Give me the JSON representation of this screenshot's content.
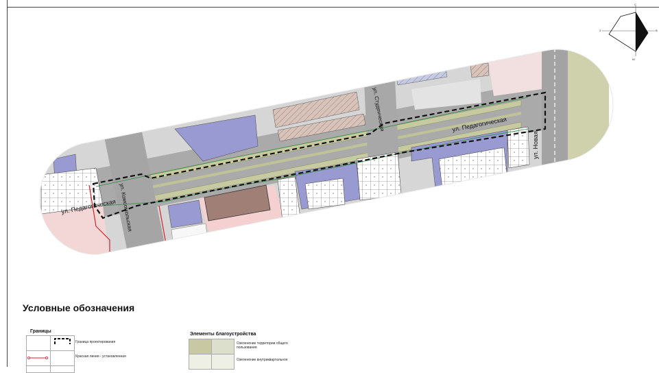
{
  "streets": {
    "pedagogicheskaya_1": "ул. Педагогическая",
    "pedagogicheskaya_2": "ул. Педагогическая",
    "komsomolskaya": "ул. Комсомольская",
    "studencheskaya": "ул. Студенческая",
    "novaya": "ул. Новая"
  },
  "compass": {
    "north_label": "С",
    "south_label": "Ю",
    "west_label": "З",
    "east_label": "В"
  },
  "legend": {
    "title": "Условные обозначения",
    "boundaries_title": "Границы",
    "boundaries": [
      {
        "label": "Граница проектирования"
      },
      {
        "label": "Красная линия - установленная"
      }
    ],
    "improvements_title": "Элементы благоустройства",
    "improvements": [
      {
        "label": "Озеленение территории общего пользования",
        "color": "#c8c9a2"
      },
      {
        "label": "Озеленение внутриквартальное",
        "color": "#eef0e6"
      }
    ]
  },
  "colors": {
    "road": "#a9a9a9",
    "sidewalk": "#d3d3d3",
    "green_strip": "#c7c9a0",
    "building_blue": "#9a9ad2",
    "building_brown": "#a08076",
    "pink_zone": "#f6d3d3",
    "red_line": "#d2222e",
    "boundary": "#111111"
  }
}
